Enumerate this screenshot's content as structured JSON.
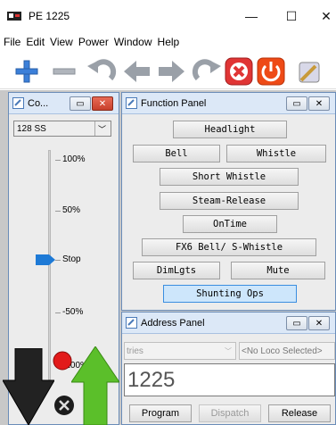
{
  "window": {
    "title": "PE 1225",
    "min": "—",
    "max": "☐",
    "close": "✕"
  },
  "menu": [
    "File",
    "Edit",
    "View",
    "Power",
    "Window",
    "Help"
  ],
  "toolbar": {
    "icons": [
      "add-icon",
      "remove-icon",
      "undo-icon",
      "back-arrow-icon",
      "forward-arrow-icon",
      "redo-icon",
      "stop-icon",
      "power-icon",
      "edit-icon"
    ],
    "colors": {
      "blue": "#3b7fd9",
      "gray": "#9aa0a8",
      "red": "#e03535",
      "orange": "#ee4a16"
    }
  },
  "throttle": {
    "title": "Co...",
    "speed_steps": "128 SS",
    "ticks": [
      "100%",
      "50%",
      "Stop",
      "-50%",
      "-100%"
    ],
    "slider_level": "Stop"
  },
  "function_panel": {
    "title": "Function Panel",
    "buttons": [
      "Headlight",
      "Bell",
      "Whistle",
      "Short Whistle",
      "Steam-Release",
      "OnTime",
      "FX6 Bell/ S-Whistle",
      "DimLgts",
      "Mute",
      "Shunting Ops"
    ],
    "active": "Shunting Ops"
  },
  "address_panel": {
    "title": "Address Panel",
    "roster_value": "tries",
    "loco_placeholder": "<No Loco Selected>",
    "address": "1225",
    "buttons": {
      "program": "Program",
      "dispatch": "Dispatch",
      "release": "Release"
    }
  }
}
